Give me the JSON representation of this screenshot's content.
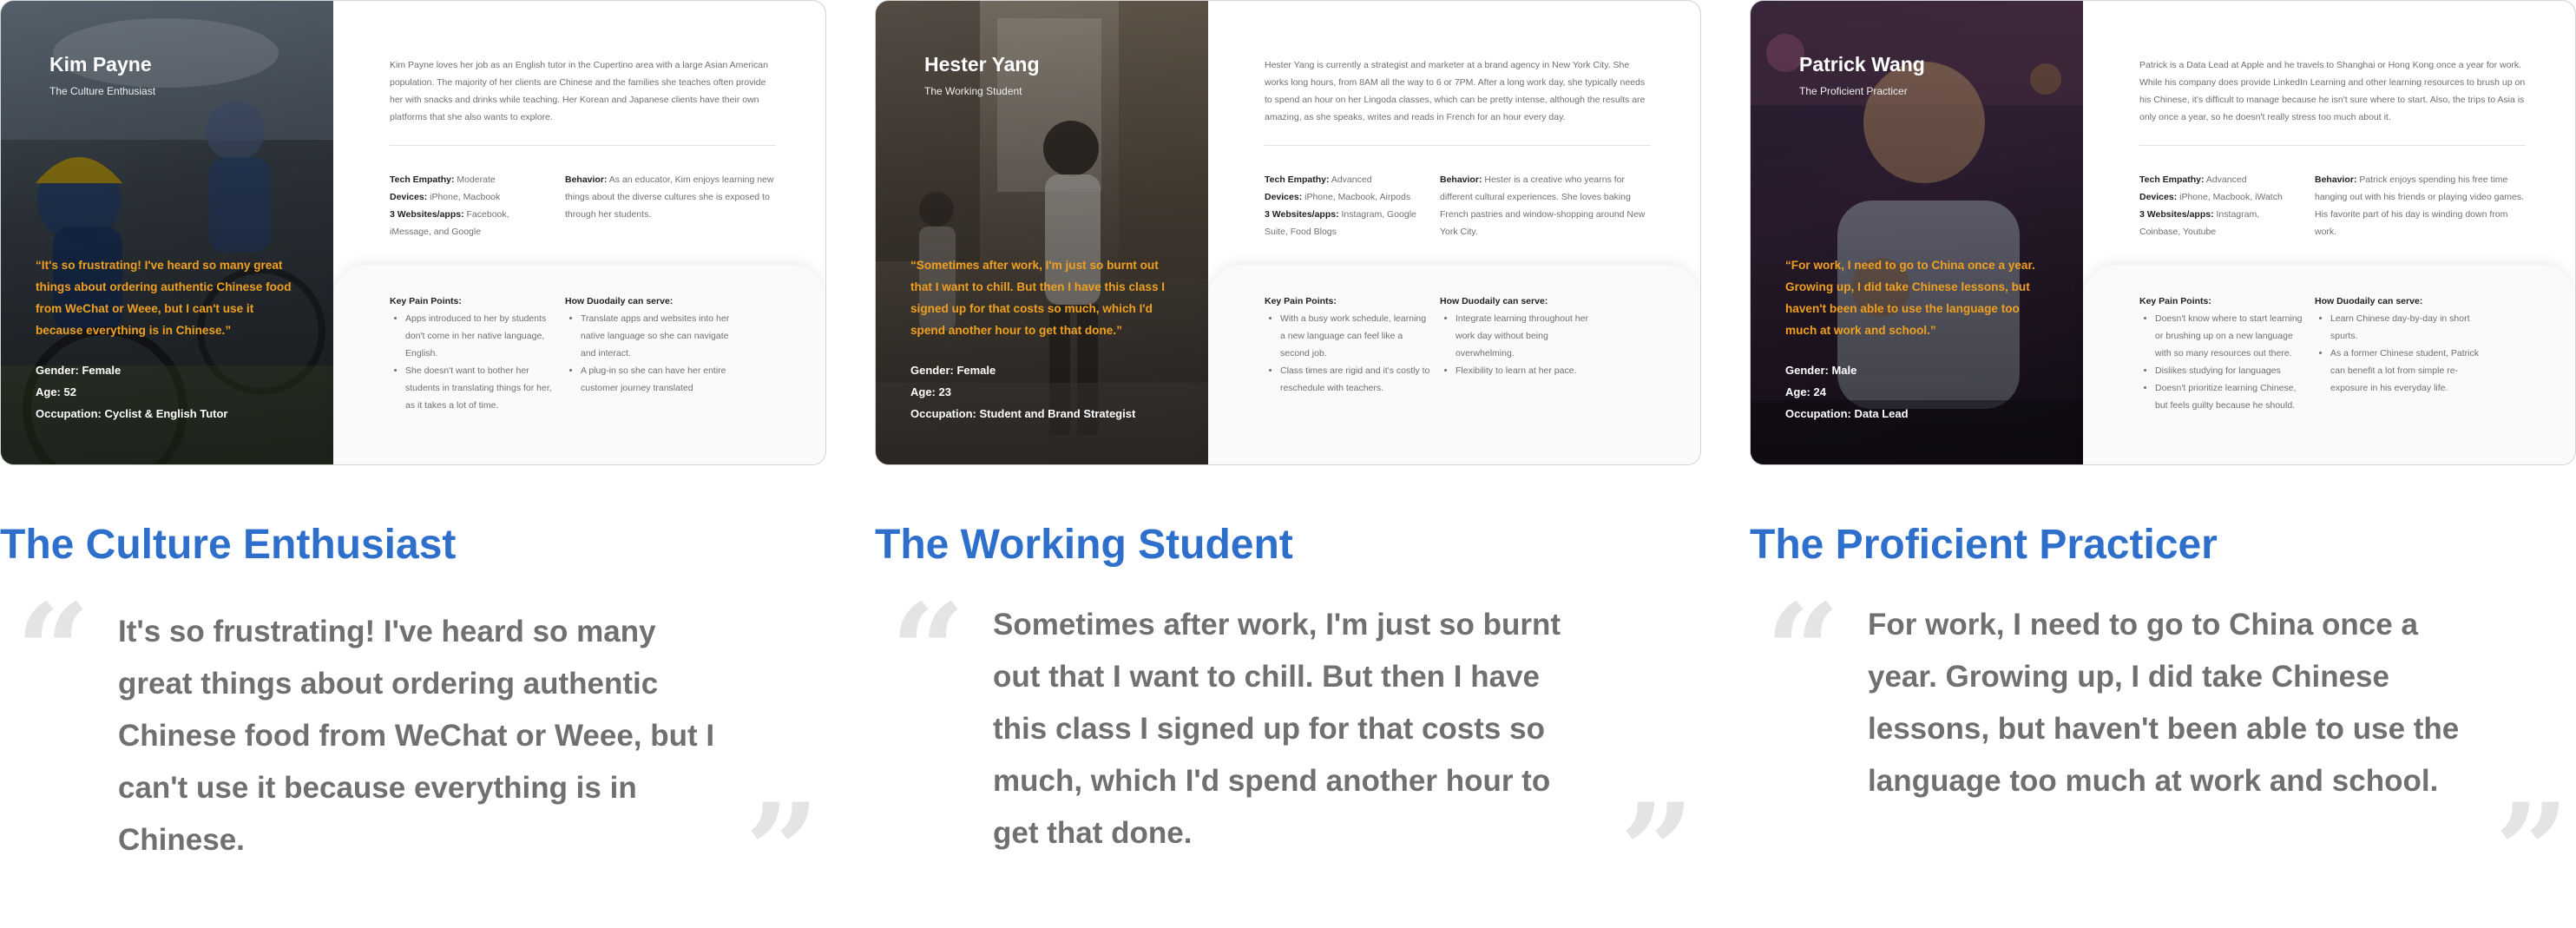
{
  "personas": [
    {
      "name": "Kim Payne",
      "tagline": "The Culture Enthusiast",
      "quote": "“It's so frustrating! I've heard so many great things about ordering authentic Chinese food from WeChat or Weee, but I can't use it because everything is in Chinese.”",
      "gender": "Gender: Female",
      "age": "Age: 52",
      "occupation": "Occupation: Cyclist & English Tutor",
      "bio": "Kim Payne loves her job as an English tutor in the Cupertino area with a large Asian American population. The majority of her clients are Chinese and the families she teaches often provide her with snacks and drinks while teaching. Her Korean and Japanese clients have their own platforms that she also wants to explore.",
      "tech_empathy_label": "Tech Empathy:",
      "tech_empathy": "Moderate",
      "devices_label": "Devices:",
      "devices": "iPhone, Macbook",
      "websites_label": "3 Websites/apps:",
      "websites": "Facebook, iMessage, and Google",
      "behavior_label": "Behavior:",
      "behavior": "As an educator, Kim enjoys learning new things about the diverse cultures she is exposed to through her students.",
      "pain_points_title": "Key Pain Points:",
      "pain_points": [
        "Apps introduced to her by students don't come in her native language, English.",
        "She doesn't want to bother her students in translating things for her, as it takes a lot of time."
      ],
      "serve_title": "How Duodaily can serve:",
      "serve": [
        "Translate apps and websites into her native language so she can navigate and interact.",
        "A plug-in so she can have her entire customer journey translated"
      ],
      "heading": "The Culture Enthusiast",
      "big_quote": "It's so frustrating! I've heard so many great things about ordering authentic Chinese food from WeChat or Weee, but I can't use it because everything is in Chinese."
    },
    {
      "name": "Hester Yang",
      "tagline": "The Working Student",
      "quote": "“Sometimes after work, I'm just so burnt out that I want to chill. But then I have this class I signed up for that costs so much, which I'd spend another hour to get that done.”",
      "gender": "Gender: Female",
      "age": "Age: 23",
      "occupation": "Occupation: Student and Brand Strategist",
      "bio": "Hester Yang is currently a strategist and marketer at a brand agency in New York City. She works long hours, from 8AM all the way to 6 or 7PM. After a long work day, she typically needs to spend an hour on her Lingoda classes, which can be pretty intense, although the results are amazing, as she speaks, writes and reads in French for an hour every day.",
      "tech_empathy_label": "Tech Empathy:",
      "tech_empathy": "Advanced",
      "devices_label": "Devices:",
      "devices": "iPhone, Macbook, Airpods",
      "websites_label": "3 Websites/apps:",
      "websites": "Instagram, Google Suite, Food Blogs",
      "behavior_label": "Behavior:",
      "behavior": "Hester is a creative who yearns for different cultural experiences. She loves baking French pastries and window-shopping around New York City.",
      "pain_points_title": "Key Pain Points:",
      "pain_points": [
        "With a busy work schedule, learning a new language can feel like a second job.",
        "Class times are rigid and it's costly to reschedule with teachers."
      ],
      "serve_title": "How Duodaily can serve:",
      "serve": [
        "Integrate learning throughout her work day without being overwhelming.",
        "Flexibility to learn at her pace."
      ],
      "heading": "The Working Student",
      "big_quote": "Sometimes after work, I'm just so burnt out that I want to chill. But then I have this class I signed up for that costs so much, which I'd spend another hour to get that done."
    },
    {
      "name": "Patrick Wang",
      "tagline": "The Proficient Practicer",
      "quote": "“For work, I need to go to China once a year. Growing up, I did take Chinese lessons, but haven't been able to use the language too much at work and school.”",
      "gender": "Gender: Male",
      "age": "Age: 24",
      "occupation": "Occupation: Data Lead",
      "bio": "Patrick is a Data Lead at Apple and he travels to Shanghai or Hong Kong once a year for work. While his company does provide LinkedIn Learning and other learning resources to brush up on his Chinese, it's difficult to manage because he isn't sure where to start. Also, the trips to Asia is only once a year, so he doesn't really stress too much about it.",
      "tech_empathy_label": "Tech Empathy:",
      "tech_empathy": "Advanced",
      "devices_label": "Devices:",
      "devices": "iPhone, Macbook, iWatch",
      "websites_label": "3 Websites/apps:",
      "websites": "Instagram, Coinbase, Youtube",
      "behavior_label": "Behavior:",
      "behavior": "Patrick enjoys spending his free time hanging out with his friends or playing video games. His favorite part of his day is winding down from work.",
      "pain_points_title": "Key Pain Points:",
      "pain_points": [
        "Doesn't know where to start learning or brushing up on a new language with so many resources out there.",
        "Dislikes studying for languages",
        "Doesn't prioritize learning Chinese, but feels guilty because he should."
      ],
      "serve_title": "How Duodaily can serve:",
      "serve": [
        "Learn Chinese day-by-day in short spurts.",
        "As a former Chinese student, Patrick can benefit a lot from simple re-exposure in his everyday life."
      ],
      "heading": "The Proficient Practicer",
      "big_quote": "For work, I need to go to China once a year. Growing up, I did take Chinese lessons, but haven't been able to use the language too much at work and school."
    }
  ],
  "open_quote_mark": "“",
  "close_quote_mark": "”",
  "colors": {
    "heading_blue": "#2f6fcc",
    "quote_orange": "#f0a020",
    "body_gray": "#707070",
    "quote_mark_gray": "#e4e4e4"
  }
}
